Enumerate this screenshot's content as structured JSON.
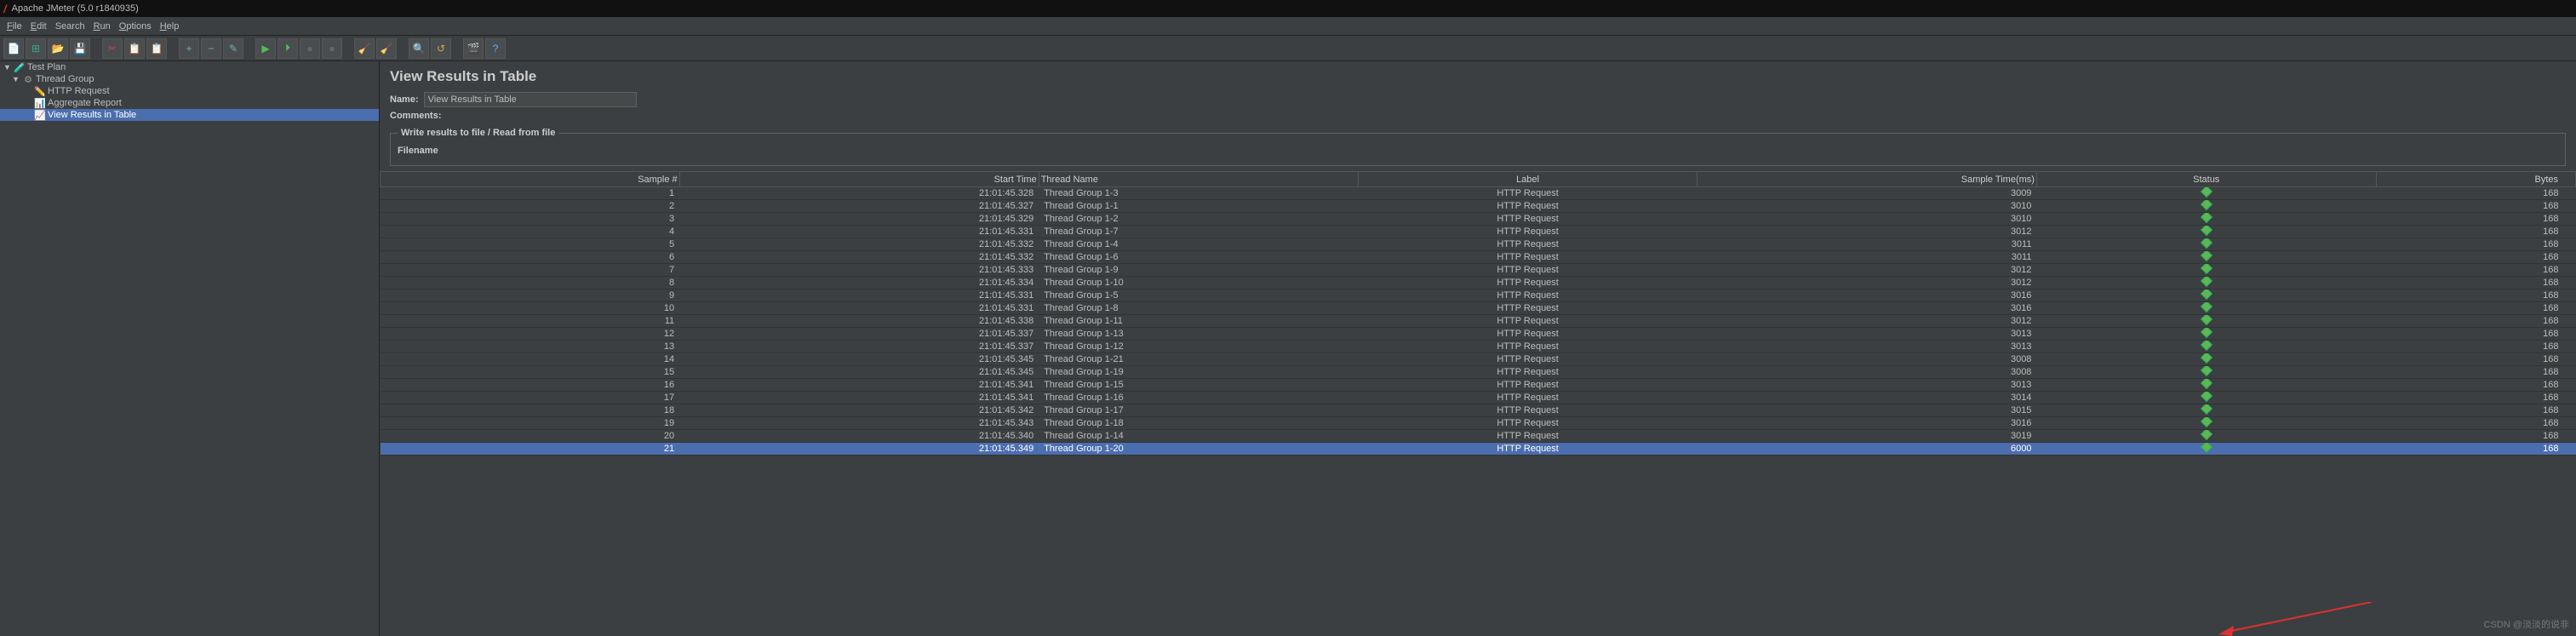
{
  "title": "Apache JMeter (5.0 r1840935)",
  "menu": {
    "file": "File",
    "edit": "Edit",
    "search": "Search",
    "run": "Run",
    "options": "Options",
    "help": "Help"
  },
  "tree": {
    "root": "Test Plan",
    "group": "Thread Group",
    "items": [
      "HTTP Request",
      "Aggregate Report",
      "View Results in Table"
    ],
    "selectedIndex": 2
  },
  "panel": {
    "title": "View Results in Table",
    "nameLabel": "Name:",
    "nameValue": "View Results in Table",
    "commentsLabel": "Comments:",
    "fieldsetLegend": "Write results to file / Read from file",
    "filenameLabel": "Filename"
  },
  "table": {
    "headers": {
      "sample": "Sample #",
      "start": "Start Time",
      "thread": "Thread Name",
      "label": "Label",
      "stime": "Sample Time(ms)",
      "status": "Status",
      "bytes": "Bytes"
    },
    "rows": [
      {
        "n": 1,
        "t": "21:01:45.328",
        "th": "Thread Group 1-3",
        "lb": "HTTP Request",
        "st": 3009,
        "by": 168
      },
      {
        "n": 2,
        "t": "21:01:45.327",
        "th": "Thread Group 1-1",
        "lb": "HTTP Request",
        "st": 3010,
        "by": 168
      },
      {
        "n": 3,
        "t": "21:01:45.329",
        "th": "Thread Group 1-2",
        "lb": "HTTP Request",
        "st": 3010,
        "by": 168
      },
      {
        "n": 4,
        "t": "21:01:45.331",
        "th": "Thread Group 1-7",
        "lb": "HTTP Request",
        "st": 3012,
        "by": 168
      },
      {
        "n": 5,
        "t": "21:01:45.332",
        "th": "Thread Group 1-4",
        "lb": "HTTP Request",
        "st": 3011,
        "by": 168
      },
      {
        "n": 6,
        "t": "21:01:45.332",
        "th": "Thread Group 1-6",
        "lb": "HTTP Request",
        "st": 3011,
        "by": 168
      },
      {
        "n": 7,
        "t": "21:01:45.333",
        "th": "Thread Group 1-9",
        "lb": "HTTP Request",
        "st": 3012,
        "by": 168
      },
      {
        "n": 8,
        "t": "21:01:45.334",
        "th": "Thread Group 1-10",
        "lb": "HTTP Request",
        "st": 3012,
        "by": 168
      },
      {
        "n": 9,
        "t": "21:01:45.331",
        "th": "Thread Group 1-5",
        "lb": "HTTP Request",
        "st": 3016,
        "by": 168
      },
      {
        "n": 10,
        "t": "21:01:45.331",
        "th": "Thread Group 1-8",
        "lb": "HTTP Request",
        "st": 3016,
        "by": 168
      },
      {
        "n": 11,
        "t": "21:01:45.338",
        "th": "Thread Group 1-11",
        "lb": "HTTP Request",
        "st": 3012,
        "by": 168
      },
      {
        "n": 12,
        "t": "21:01:45.337",
        "th": "Thread Group 1-13",
        "lb": "HTTP Request",
        "st": 3013,
        "by": 168
      },
      {
        "n": 13,
        "t": "21:01:45.337",
        "th": "Thread Group 1-12",
        "lb": "HTTP Request",
        "st": 3013,
        "by": 168
      },
      {
        "n": 14,
        "t": "21:01:45.345",
        "th": "Thread Group 1-21",
        "lb": "HTTP Request",
        "st": 3008,
        "by": 168
      },
      {
        "n": 15,
        "t": "21:01:45.345",
        "th": "Thread Group 1-19",
        "lb": "HTTP Request",
        "st": 3008,
        "by": 168
      },
      {
        "n": 16,
        "t": "21:01:45.341",
        "th": "Thread Group 1-15",
        "lb": "HTTP Request",
        "st": 3013,
        "by": 168
      },
      {
        "n": 17,
        "t": "21:01:45.341",
        "th": "Thread Group 1-16",
        "lb": "HTTP Request",
        "st": 3014,
        "by": 168
      },
      {
        "n": 18,
        "t": "21:01:45.342",
        "th": "Thread Group 1-17",
        "lb": "HTTP Request",
        "st": 3015,
        "by": 168
      },
      {
        "n": 19,
        "t": "21:01:45.343",
        "th": "Thread Group 1-18",
        "lb": "HTTP Request",
        "st": 3016,
        "by": 168
      },
      {
        "n": 20,
        "t": "21:01:45.340",
        "th": "Thread Group 1-14",
        "lb": "HTTP Request",
        "st": 3019,
        "by": 168
      },
      {
        "n": 21,
        "t": "21:01:45.349",
        "th": "Thread Group 1-20",
        "lb": "HTTP Request",
        "st": 6000,
        "by": 168
      }
    ],
    "selectedRow": 20
  },
  "watermark": "CSDN @淡淡的说非"
}
